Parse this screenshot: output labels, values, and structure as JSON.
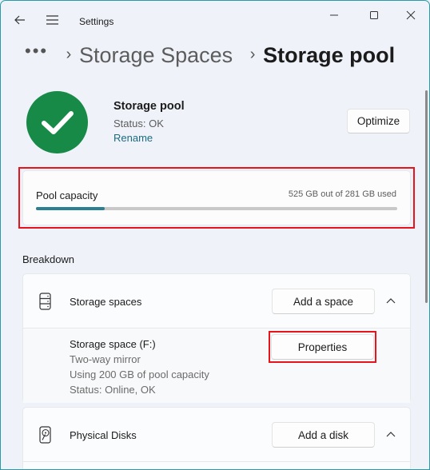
{
  "window": {
    "title": "Settings",
    "controls": {
      "minimize": "minimize",
      "maximize": "maximize",
      "close": "close"
    }
  },
  "breadcrumb": {
    "more": "•••",
    "items": [
      {
        "label": "Storage Spaces"
      },
      {
        "label": "Storage pool"
      }
    ]
  },
  "pool": {
    "name": "Storage pool",
    "status": "Status: OK",
    "rename_label": "Rename",
    "optimize_label": "Optimize",
    "status_color": "#178a47"
  },
  "capacity": {
    "label": "Pool capacity",
    "used_text": "525  GB out of 281  GB used",
    "fill_percent": 19,
    "accent_color": "#2b7f92"
  },
  "breakdown": {
    "heading": "Breakdown",
    "storage_spaces": {
      "title": "Storage spaces",
      "add_label": "Add a space",
      "expanded": true,
      "items": [
        {
          "name": "Storage space (F:)",
          "resiliency": "Two-way mirror",
          "usage": "Using 200  GB of pool capacity",
          "status": "Status: Online, OK",
          "properties_label": "Properties"
        }
      ]
    },
    "physical_disks": {
      "title": "Physical Disks",
      "add_label": "Add a disk",
      "expanded": true
    }
  }
}
